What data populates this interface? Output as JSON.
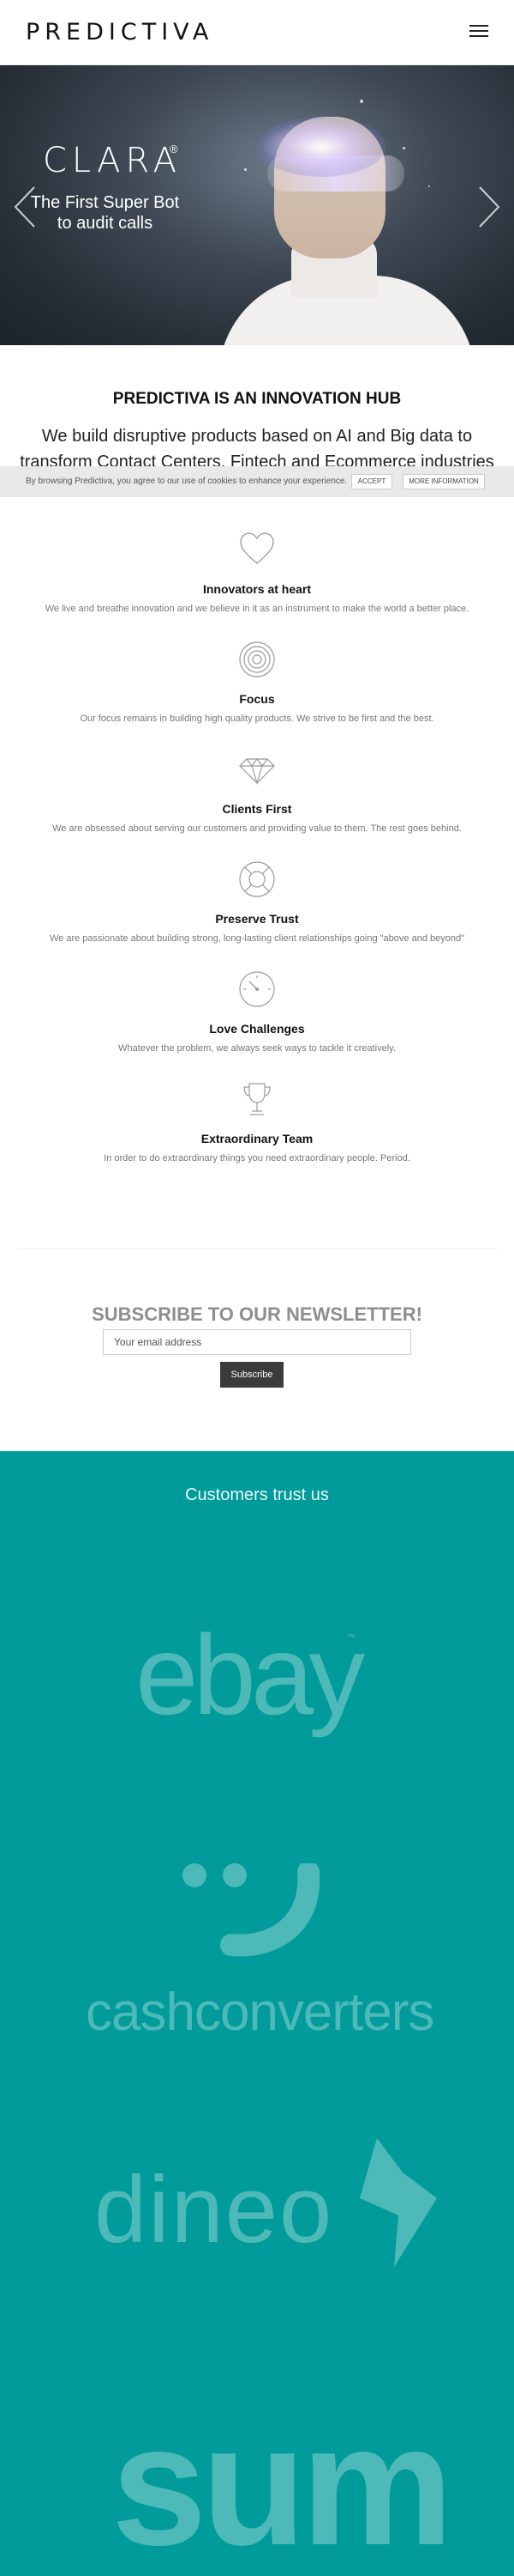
{
  "header": {
    "logo_text": "PREDICTIVA",
    "menu_icon": "hamburger-menu-icon"
  },
  "hero": {
    "title": "CLARA",
    "registered_mark": "®",
    "subtitle": "The First Super Bot to audit calls",
    "prev_icon": "chevron-left-icon",
    "next_icon": "chevron-right-icon"
  },
  "hub": {
    "title": "PREDICTIVA IS AN INNOVATION HUB",
    "description": "We build disruptive products based on AI and Big data to transform Contact Centers, Fintech and Ecommerce industries"
  },
  "cookie_bar": {
    "text": "By browsing Predictiva, you agree to our use of cookies to enhance your experience.",
    "accept_label": "ACCEPT",
    "more_label": "MORE INFORMATION"
  },
  "values": [
    {
      "icon": "heart-icon",
      "title": "Innovators at heart",
      "text": "We live and breathe innovation and we believe in it as an instrument to make the world a better place."
    },
    {
      "icon": "target-icon",
      "title": "Focus",
      "text": "Our focus remains in building high quality products. We strive to be first and the best."
    },
    {
      "icon": "diamond-icon",
      "title": "Clients First",
      "text": "We are obsessed about serving our customers and providing value to them. The rest goes behind."
    },
    {
      "icon": "lifebuoy-icon",
      "title": "Preserve Trust",
      "text": "We are passionate about building strong, long-lasting client relationships going \"above and beyond\""
    },
    {
      "icon": "speedometer-icon",
      "title": "Love Challenges",
      "text": "Whatever the problem, we always seek ways to tackle it creatively."
    },
    {
      "icon": "trophy-icon",
      "title": "Extraordinary Team",
      "text": "In order to do extraordinary things you need extraordinary people. Period."
    }
  ],
  "newsletter": {
    "title": "SUBSCRIBE TO OUR NEWSLETTER!",
    "input_placeholder": "Your email address",
    "button_label": "Subscribe"
  },
  "customers": {
    "title": "Customers trust us",
    "logos": [
      "ebay",
      "cashconverters",
      "dineo",
      "sum"
    ]
  },
  "colors": {
    "accent_teal": "#009b9a",
    "button_dark": "#3b3b3b",
    "cookie_bg": "#e9e9e9"
  }
}
